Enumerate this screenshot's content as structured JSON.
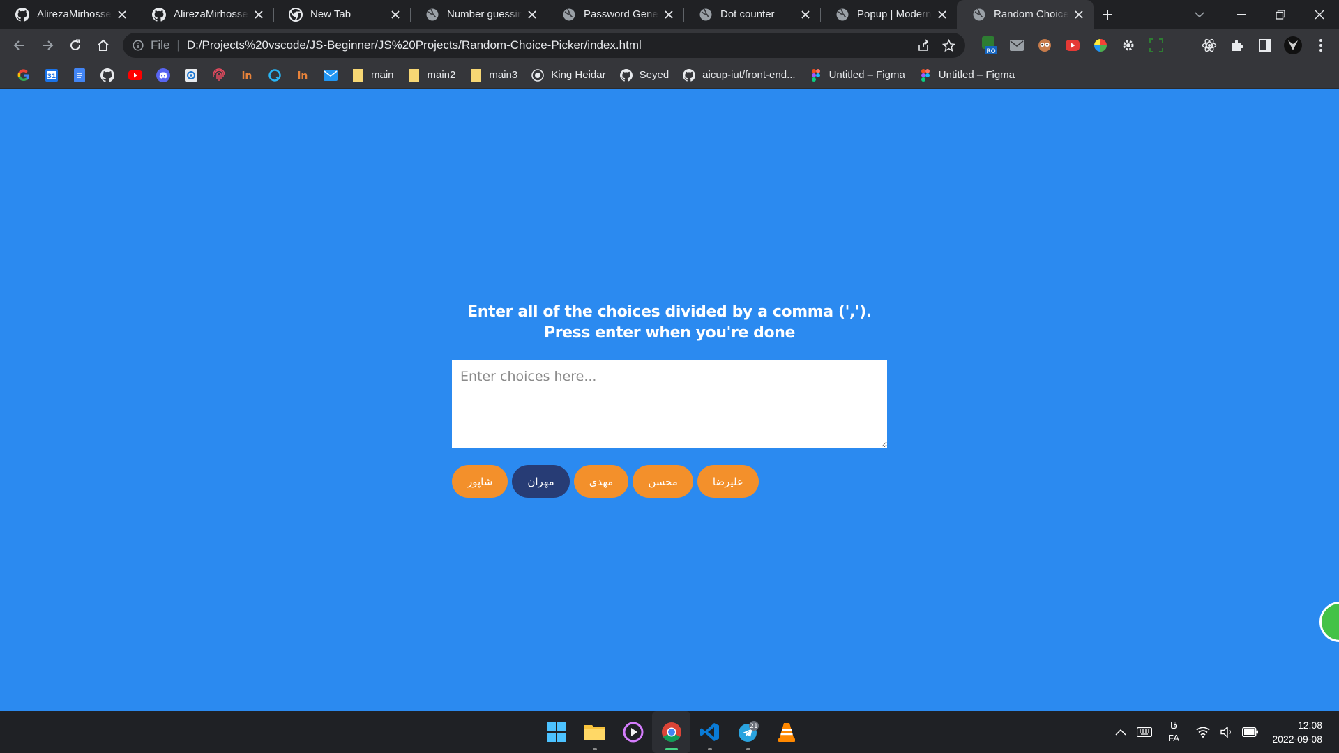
{
  "browser": {
    "tabs": [
      {
        "title": "AlirezaMirhossein",
        "icon": "github-icon",
        "active": false
      },
      {
        "title": "AlirezaMirhossein",
        "icon": "github-icon",
        "active": false
      },
      {
        "title": "New Tab",
        "icon": "chrome-icon",
        "active": false
      },
      {
        "title": "Number guessing",
        "icon": "globe-icon",
        "active": false
      },
      {
        "title": "Password Genera",
        "icon": "globe-icon",
        "active": false
      },
      {
        "title": "Dot counter",
        "icon": "globe-icon",
        "active": false
      },
      {
        "title": "Popup | Modern",
        "icon": "globe-icon",
        "active": false
      },
      {
        "title": "Random Choice P",
        "icon": "globe-icon",
        "active": true
      }
    ],
    "address": {
      "scheme": "File",
      "url": "D:/Projects%20vscode/JS-Beginner/JS%20Projects/Random-Choice-Picker/index.html"
    },
    "bookmarks": [
      {
        "label": "main",
        "icon": "folder-icon"
      },
      {
        "label": "main2",
        "icon": "folder-icon"
      },
      {
        "label": "main3",
        "icon": "folder-icon"
      },
      {
        "label": "King Heidar",
        "icon": "site-icon"
      },
      {
        "label": "Seyed",
        "icon": "github-icon"
      },
      {
        "label": "aicup-iut/front-end...",
        "icon": "github-icon"
      },
      {
        "label": "Untitled – Figma",
        "icon": "figma-icon"
      },
      {
        "label": "Untitled – Figma",
        "icon": "figma-icon"
      }
    ],
    "bookmark_icons": [
      "google-icon",
      "calendar-icon",
      "docs-icon",
      "github-icon",
      "youtube-icon",
      "discord-icon",
      "app-icon",
      "fingerprint-icon",
      "in-icon",
      "circle-q-icon",
      "in-icon",
      "mail-icon"
    ],
    "extension_badge": "RO"
  },
  "page": {
    "heading_line1": "Enter all of the choices divided by a comma (',').",
    "heading_line2": "Press enter when you're done",
    "textarea_placeholder": "Enter choices here...",
    "tags": [
      {
        "label": "علیرضا",
        "highlight": false
      },
      {
        "label": "محسن",
        "highlight": false
      },
      {
        "label": "مهدی",
        "highlight": false
      },
      {
        "label": "مهران",
        "highlight": true
      },
      {
        "label": "شاپور",
        "highlight": false
      }
    ],
    "colors": {
      "background": "#2b8af0",
      "tag": "#f3902b",
      "tag_highlight": "#273c75"
    }
  },
  "taskbar": {
    "apps": [
      "windows-start-icon",
      "file-explorer-icon",
      "media-player-icon",
      "chrome-icon",
      "vscode-icon",
      "telegram-icon",
      "vlc-icon"
    ],
    "telegram_badge": "21",
    "language_top": "فا",
    "language_bottom": "FA",
    "time": "12:08",
    "date": "2022-09-08"
  }
}
